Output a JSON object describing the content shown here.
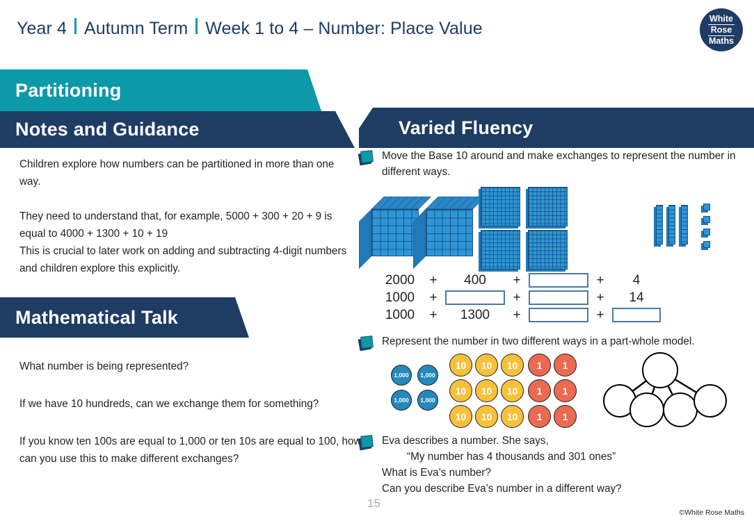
{
  "header": {
    "year": "Year 4",
    "term": "Autumn Term",
    "week_topic": "Week 1 to 4 – Number: Place Value",
    "logo": {
      "line1": "White",
      "line2": "Rose",
      "line3": "Maths"
    }
  },
  "banners": {
    "topic": "Partitioning",
    "notes": "Notes and Guidance",
    "talk": "Mathematical Talk",
    "fluency": "Varied Fluency"
  },
  "notes": {
    "para1": "Children explore how numbers can be partitioned in more than one way.",
    "para2_line1": "They need to understand that, for example, 5000 + 300 + 20 + 9 is equal to 4000 + 1300 + 10 + 19",
    "para2_line2": "This is crucial to later work on adding and subtracting 4-digit numbers and children explore this explicitly."
  },
  "talk": {
    "q1": "What number is being represented?",
    "q2": "If we have 10 hundreds, can we exchange them for something?",
    "q3": "If you know ten 100s are equal to 1,000 or ten 10s are equal to 100, how can you use this to make different exchanges?"
  },
  "fluency": {
    "item1": "Move the Base 10 around and make exchanges to represent the number in different ways.",
    "item2": "Represent the number in two different ways in a part-whole model.",
    "item3_line1": "Eva describes a number. She says,",
    "item3_line2": "“My number has 4 thousands and 301 ones”",
    "item3_line3": "What is Eva’s number?",
    "item3_line4": "Can you describe Eva’s number in a different way?"
  },
  "base10": {
    "thousands_count": 2,
    "hundreds_count": 4,
    "tens_count": 3,
    "ones_count": 4,
    "represented_number": 2434
  },
  "equations": {
    "rows": [
      {
        "terms": [
          "2000",
          "400",
          "",
          "4"
        ],
        "blanks": [
          2
        ]
      },
      {
        "terms": [
          "1000",
          "",
          "",
          "14"
        ],
        "blanks": [
          1,
          2
        ]
      },
      {
        "terms": [
          "1000",
          "1300",
          "",
          ""
        ],
        "blanks": [
          2,
          3
        ]
      }
    ],
    "operator": "+"
  },
  "counters": {
    "thousand_label": "1,000",
    "ten_label": "10",
    "one_label": "1",
    "thousand_count": 4,
    "ten_count": 9,
    "one_count": 6
  },
  "part_whole": {
    "whole_count": 1,
    "part_count": 4
  },
  "footer": {
    "page_number": "15",
    "copyright": "©White Rose Maths"
  },
  "colors": {
    "teal": "#0d9aa8",
    "navy": "#1e3c64",
    "block_blue": "#2e96d8",
    "counter_blue": "#2388bd",
    "counter_yellow": "#f8c13c",
    "counter_red": "#ea6a52"
  }
}
